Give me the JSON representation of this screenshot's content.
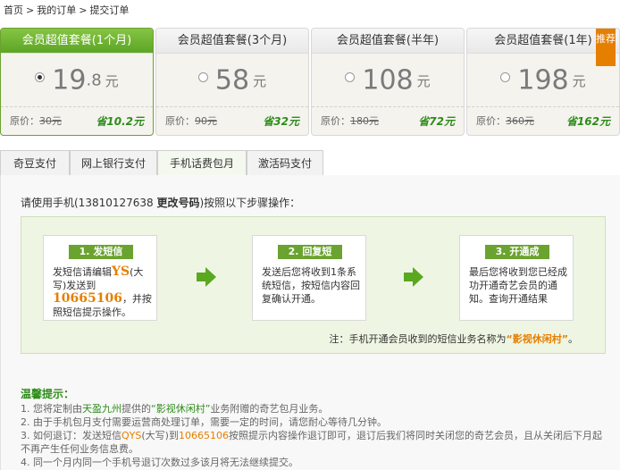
{
  "breadcrumb": [
    "首页",
    ">",
    "我的订单",
    ">",
    "提交订单"
  ],
  "plans": [
    {
      "title": "会员超值套餐(1个月)",
      "price_int": "19",
      "price_dec": ".8",
      "unit": "元",
      "orig_label": "原价：",
      "orig_price": "30元",
      "save": "省10.2元",
      "selected": true
    },
    {
      "title": "会员超值套餐(3个月)",
      "price_int": "58",
      "price_dec": "",
      "unit": "元",
      "orig_label": "原价：",
      "orig_price": "90元",
      "save": "省32元",
      "selected": false
    },
    {
      "title": "会员超值套餐(半年)",
      "price_int": "108",
      "price_dec": "",
      "unit": "元",
      "orig_label": "原价：",
      "orig_price": "180元",
      "save": "省72元",
      "selected": false
    },
    {
      "title": "会员超值套餐(1年)",
      "price_int": "198",
      "price_dec": "",
      "unit": "元",
      "orig_label": "原价：",
      "orig_price": "360元",
      "save": "省162元",
      "selected": false,
      "badge": "推荐"
    }
  ],
  "tabs": [
    "奇豆支付",
    "网上银行支付",
    "手机话费包月",
    "激活码支付"
  ],
  "active_tab": 2,
  "instruction": {
    "prefix": "请使用手机(13810127638 ",
    "link": "更改号码",
    "suffix": ")按照以下步骤操作："
  },
  "steps": [
    {
      "title": "1. 发短信",
      "text_a": "发短信请编辑",
      "kw1": "YS",
      "text_b": "(大写)发送到",
      "kw2": "10665106",
      "text_c": "，并按照短信提示操作。"
    },
    {
      "title": "2. 回复短",
      "text": "发送后您将收到1条系统短信，按短信内容回复确认开通。"
    },
    {
      "title": "3. 开通成",
      "text": "最后您将收到您已经成功开通奇艺会员的通知。查询开通结果"
    }
  ],
  "steps_note": {
    "prefix": "注：手机开通会员收到的短信业务名称为",
    "hl": "“影视休闲村”",
    "suffix": "。"
  },
  "tips": {
    "title": "温馨提示：",
    "line1_a": "1. 您将定制由",
    "line1_b": "天盈九州",
    "line1_c": "提供的",
    "line1_d": "“影视休闲村”",
    "line1_e": "业务附赠的奇艺包月业务。",
    "line2": "2. 由于手机包月支付需要运营商处理订单，需要一定的时间，请您耐心等待几分钟。",
    "line3_a": "3. 如何退订：发送短信",
    "line3_b": "QYS",
    "line3_c": "(大写)到",
    "line3_d": "10665106",
    "line3_e": "按照提示内容操作退订即可，退订后我们将同时关闭您的奇艺会员，且从关闭后下月起不再产生任何业务信息费。",
    "line4": "4. 同一个月内同一个手机号退订次数过多该月将无法继续提交。"
  },
  "colors": {
    "accent_green": "#6aa32f",
    "orange": "#e67e00",
    "save_green": "#2e8c1a"
  }
}
